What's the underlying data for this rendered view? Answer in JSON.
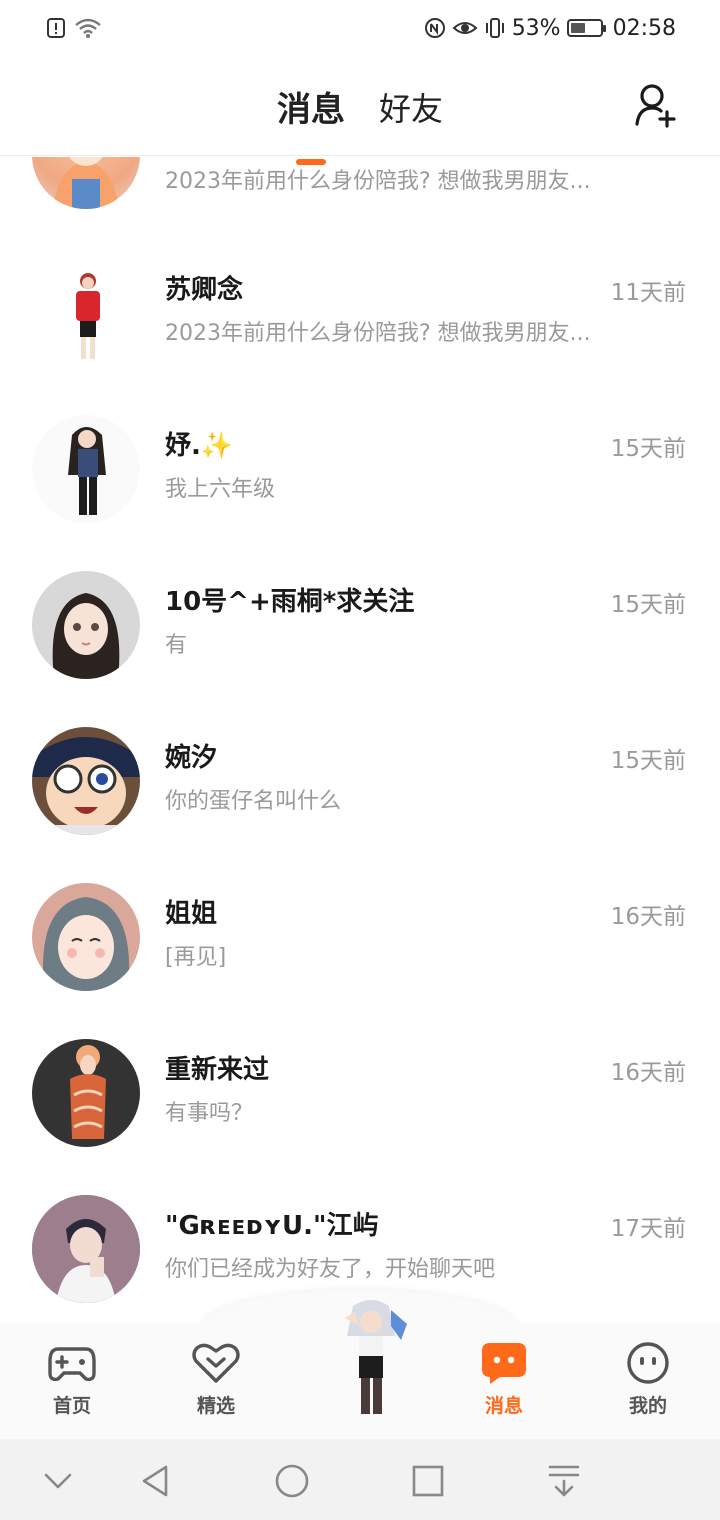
{
  "status_bar": {
    "battery_percent": "53%",
    "battery_level": 0.53,
    "time": "02:58",
    "icons": [
      "alert-icon",
      "wifi-icon",
      "nfc-icon",
      "eye-comfort-icon",
      "vibrate-icon"
    ]
  },
  "header": {
    "tabs": [
      {
        "label": "消息",
        "active": true
      },
      {
        "label": "好友",
        "active": false
      }
    ],
    "add_friend_icon": "add-friend-icon"
  },
  "accent_color": "#ff6a1a",
  "conversations": [
    {
      "name": "",
      "time": "",
      "preview": "2023年前用什么身份陪我? 想做我男朋友..."
    },
    {
      "name": "苏卿念",
      "time": "11天前",
      "preview": "2023年前用什么身份陪我? 想做我男朋友..."
    },
    {
      "name": "妤.✨",
      "time": "15天前",
      "preview": "我上六年级"
    },
    {
      "name": "10号^+雨桐*求关注",
      "time": "15天前",
      "preview": "有"
    },
    {
      "name": "婉汐",
      "time": "15天前",
      "preview": "你的蛋仔名叫什么"
    },
    {
      "name": "姐姐",
      "time": "16天前",
      "preview": "[再见]"
    },
    {
      "name": "重新来过",
      "time": "16天前",
      "preview": "有事吗？"
    },
    {
      "name": "\"GʀᴇᴇᴅʏU.\"江屿",
      "time": "17天前",
      "preview": "你们已经成为好友了，开始聊天吧"
    }
  ],
  "bottom_nav": {
    "items": [
      {
        "label": "首页",
        "icon": "gamepad-icon",
        "active": false
      },
      {
        "label": "精选",
        "icon": "heart-chevron-icon",
        "active": false
      },
      {
        "label": "消息",
        "icon": "chat-bubble-icon",
        "active": true
      },
      {
        "label": "我的",
        "icon": "face-icon",
        "active": false
      }
    ],
    "center_icon": "character-avatar"
  },
  "system_nav": [
    "chevron-down-icon",
    "back-triangle-icon",
    "home-circle-icon",
    "recents-square-icon",
    "download-icon"
  ]
}
